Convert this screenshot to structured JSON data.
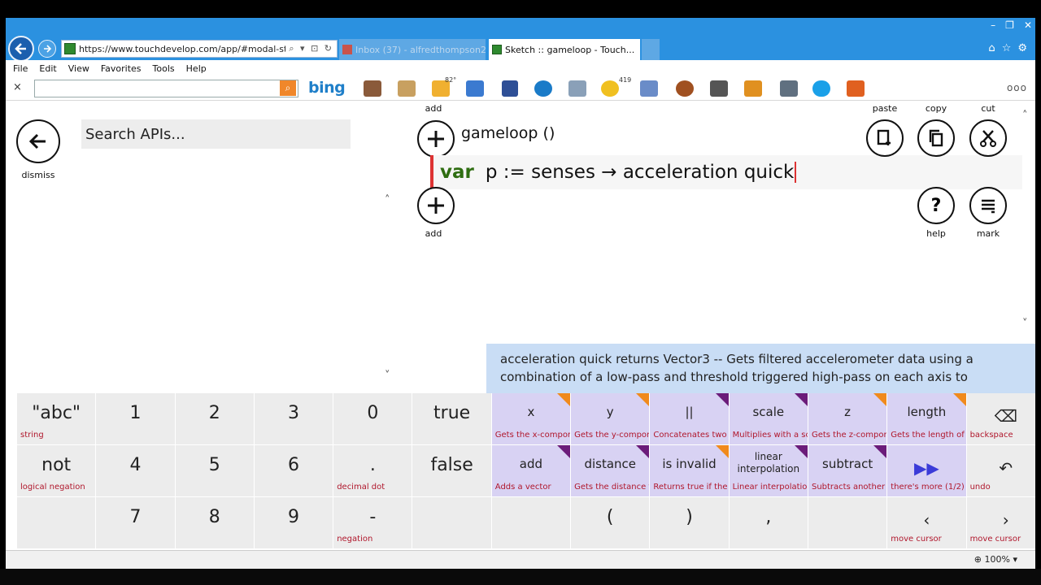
{
  "browser": {
    "url": "https://www.touchdevelop.com/app/#modal-stmt",
    "tabs": [
      {
        "label": "Inbox (37) - alfredthompson2..."
      },
      {
        "label": "Sketch :: gameloop - Touch..."
      }
    ],
    "menu": [
      "File",
      "Edit",
      "View",
      "Favorites",
      "Tools",
      "Help"
    ],
    "toolbar_search_value": "",
    "bing_label": "bing",
    "weather_badge": "82°",
    "mail_badge": "419",
    "zoom": "100%"
  },
  "editor": {
    "dismiss_label": "dismiss",
    "search_placeholder": "Search APIs...",
    "add_label": "add",
    "action_title": "gameloop ()",
    "code_keyword": "var",
    "code_expr": "p  :=  senses → acceleration quick",
    "paste_label": "paste",
    "copy_label": "copy",
    "cut_label": "cut",
    "help_label": "help",
    "mark_label": "mark"
  },
  "help_text": "acceleration quick returns Vector3 -- Gets filtered accelerometer data using a combination of a low-pass and threshold triggered high-pass on each axis to",
  "keyboard": {
    "row1": [
      {
        "label": "\"abc\"",
        "sub": "string"
      },
      {
        "label": "1",
        "sub": ""
      },
      {
        "label": "2",
        "sub": ""
      },
      {
        "label": "3",
        "sub": ""
      },
      {
        "label": "0",
        "sub": ""
      },
      {
        "label": "true",
        "sub": ""
      },
      {
        "label": "x",
        "sub": "Gets the x-compor"
      },
      {
        "label": "y",
        "sub": "Gets the y-compor"
      },
      {
        "label": "||",
        "sub": "Concatenates two"
      },
      {
        "label": "scale",
        "sub": "Multiplies with a sc"
      },
      {
        "label": "z",
        "sub": "Gets the z-compor"
      },
      {
        "label": "length",
        "sub": "Gets the length of"
      },
      {
        "label": "",
        "sub": "backspace"
      }
    ],
    "row2": [
      {
        "label": "not",
        "sub": "logical negation"
      },
      {
        "label": "4",
        "sub": ""
      },
      {
        "label": "5",
        "sub": ""
      },
      {
        "label": "6",
        "sub": ""
      },
      {
        "label": ".",
        "sub": "decimal dot"
      },
      {
        "label": "false",
        "sub": ""
      },
      {
        "label": "add",
        "sub": "Adds a vector"
      },
      {
        "label": "distance",
        "sub": "Gets the distance t"
      },
      {
        "label": "is invalid",
        "sub": "Returns true if the"
      },
      {
        "label": "linear interpolation",
        "sub": "Linear interpolatio"
      },
      {
        "label": "subtract",
        "sub": "Subtracts another"
      },
      {
        "label": "",
        "sub": "there's more (1/2)"
      },
      {
        "label": "",
        "sub": "undo"
      }
    ],
    "row3": [
      {
        "label": "",
        "sub": ""
      },
      {
        "label": "7",
        "sub": ""
      },
      {
        "label": "8",
        "sub": ""
      },
      {
        "label": "9",
        "sub": ""
      },
      {
        "label": "-",
        "sub": "negation"
      },
      {
        "label": "",
        "sub": ""
      },
      {
        "label": "",
        "sub": ""
      },
      {
        "label": "(",
        "sub": ""
      },
      {
        "label": ")",
        "sub": ""
      },
      {
        "label": ",",
        "sub": ""
      },
      {
        "label": "",
        "sub": ""
      },
      {
        "label": "",
        "sub": "move cursor"
      },
      {
        "label": "",
        "sub": "move cursor"
      }
    ]
  },
  "colors": {
    "accent": "#2b91e0",
    "library_key": "#d8d2f3",
    "key": "#ececec",
    "sub_text": "#b0172c",
    "help_panel": "#c9ddf5",
    "keyword": "#2f6e12",
    "corner_orange": "#f08a1c",
    "corner_purple": "#6b1c7a"
  }
}
